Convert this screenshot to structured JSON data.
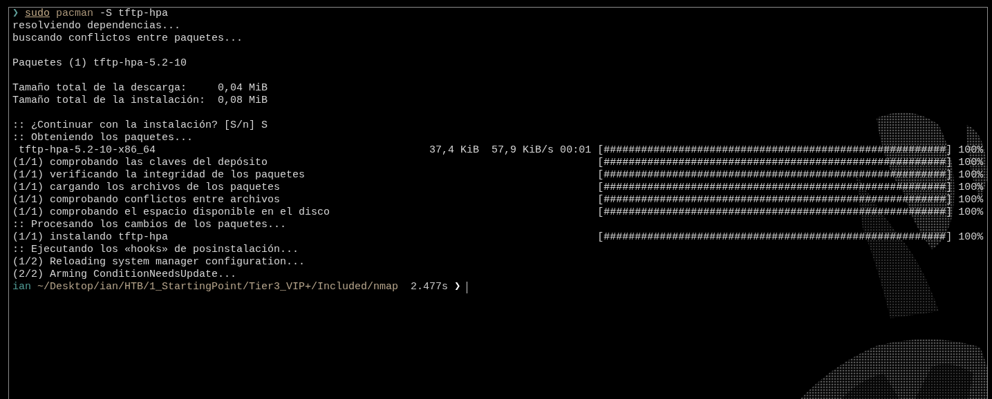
{
  "command": {
    "prompt_symbol": "❯",
    "sudo": "sudo",
    "program": "pacman",
    "args": "-S tftp-hpa"
  },
  "lines": [
    {
      "kind": "text",
      "text": "resolviendo dependencias..."
    },
    {
      "kind": "text",
      "text": "buscando conflictos entre paquetes..."
    },
    {
      "kind": "blank"
    },
    {
      "kind": "text",
      "text": "Paquetes (1) tftp-hpa-5.2-10"
    },
    {
      "kind": "blank"
    },
    {
      "kind": "text",
      "text": "Tamaño total de la descarga:     0,04 MiB"
    },
    {
      "kind": "text",
      "text": "Tamaño total de la instalación:  0,08 MiB"
    },
    {
      "kind": "blank"
    },
    {
      "kind": "text",
      "text": ":: ¿Continuar con la instalación? [S/n] S"
    },
    {
      "kind": "text",
      "text": ":: Obteniendo los paquetes..."
    },
    {
      "kind": "progress",
      "text": " tftp-hpa-5.2-10-x86_64",
      "stats": "37,4 KiB  57,9 KiB/s 00:01",
      "bar": "[#######################################################]",
      "percent": "100%"
    },
    {
      "kind": "progress",
      "text": "(1/1) comprobando las claves del depósito",
      "bar": "[#######################################################]",
      "percent": "100%"
    },
    {
      "kind": "progress",
      "text": "(1/1) verificando la integridad de los paquetes",
      "bar": "[#######################################################]",
      "percent": "100%"
    },
    {
      "kind": "progress",
      "text": "(1/1) cargando los archivos de los paquetes",
      "bar": "[#######################################################]",
      "percent": "100%"
    },
    {
      "kind": "progress",
      "text": "(1/1) comprobando conflictos entre archivos",
      "bar": "[#######################################################]",
      "percent": "100%"
    },
    {
      "kind": "progress",
      "text": "(1/1) comprobando el espacio disponible en el disco",
      "bar": "[#######################################################]",
      "percent": "100%"
    },
    {
      "kind": "text",
      "text": ":: Procesando los cambios de los paquetes..."
    },
    {
      "kind": "progress",
      "text": "(1/1) instalando tftp-hpa",
      "bar": "[#######################################################]",
      "percent": "100%"
    },
    {
      "kind": "text",
      "text": ":: Ejecutando los «hooks» de posinstalación..."
    },
    {
      "kind": "text",
      "text": "(1/2) Reloading system manager configuration..."
    },
    {
      "kind": "text",
      "text": "(2/2) Arming ConditionNeedsUpdate..."
    }
  ],
  "prompt": {
    "user": "ian",
    "path": "~/Desktop/ian/HTB/1_StartingPoint/Tier3_VIP+/Included/nmap",
    "duration": "2.477s",
    "symbol": "❯"
  }
}
